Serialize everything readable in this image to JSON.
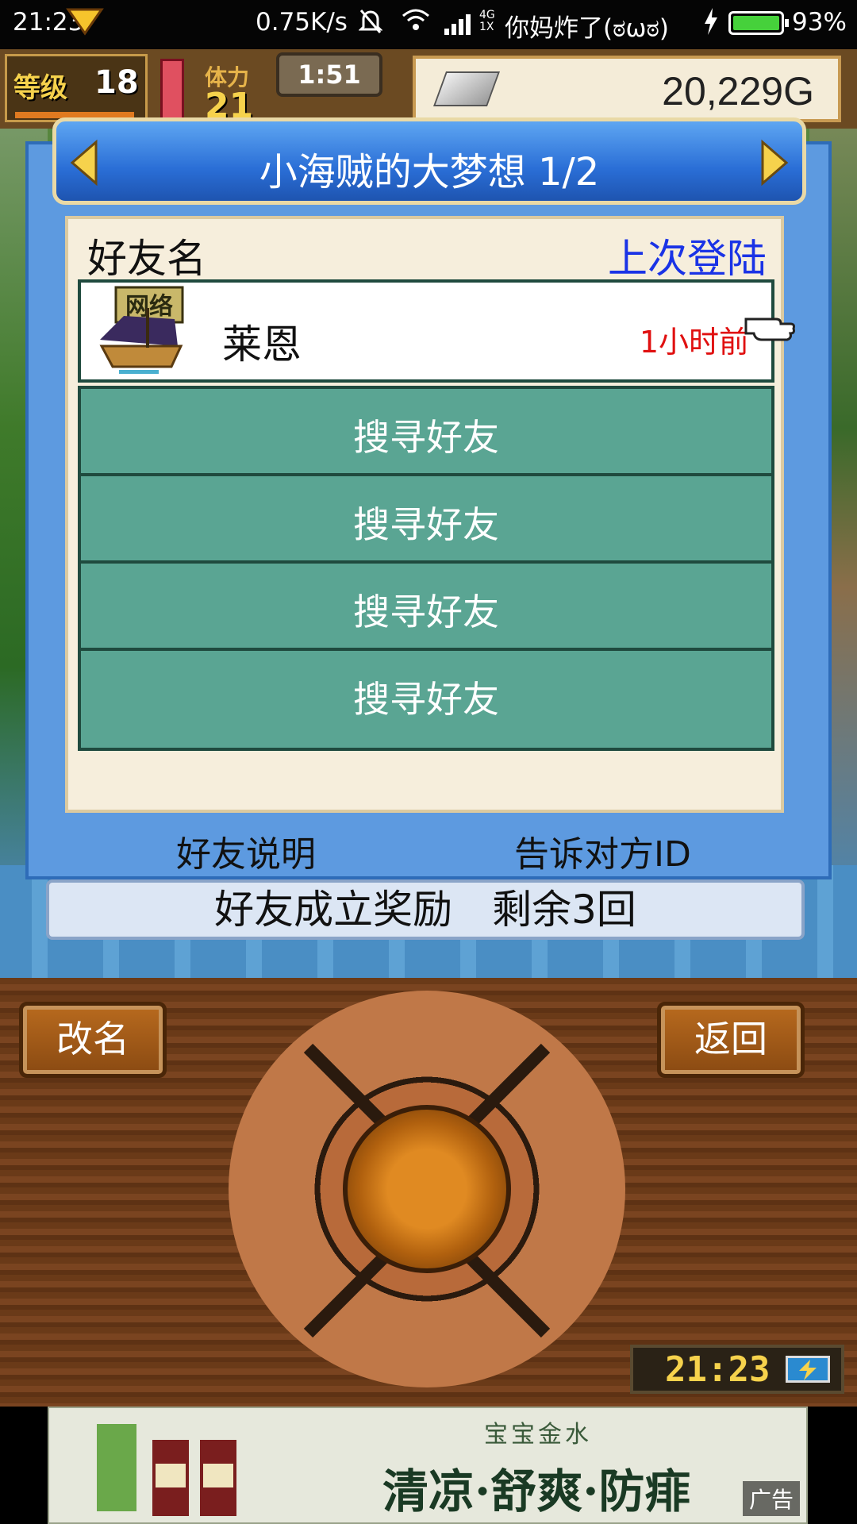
{
  "status_bar": {
    "time": "21:23",
    "net_speed": "0.75K/s",
    "network_type": "4G\n1X",
    "carrier": "你妈炸了(ಠωಠ)",
    "battery": "93%"
  },
  "hud": {
    "level_label": "等级",
    "level_value": "18",
    "stamina_label": "体力",
    "stamina_value": "21",
    "timer": "1:51",
    "gold": "20,229G"
  },
  "dialog": {
    "title": "小海贼的大梦想 1/2",
    "col_friend_name": "好友名",
    "col_last_login": "上次登陆",
    "friends": [
      {
        "badge": "网络",
        "name": "莱恩",
        "last_login": "1小时前"
      }
    ],
    "search_rows": [
      "搜寻好友",
      "搜寻好友",
      "搜寻好友",
      "搜寻好友"
    ],
    "friend_help": "好友说明",
    "tell_id": "告诉对方ID",
    "reward": "好友成立奖励　剩余3回"
  },
  "console": {
    "rename": "改名",
    "back": "返回",
    "clock": "21:23"
  },
  "ad": {
    "top_text": "宝宝金水",
    "main_text": "清凉·舒爽·防痱",
    "tag": "广告"
  },
  "colors": {
    "dialog_blue": "#5d9ae0",
    "search_teal": "#5aa593",
    "login_blue": "#1a33e6",
    "time_red": "#e01010"
  }
}
